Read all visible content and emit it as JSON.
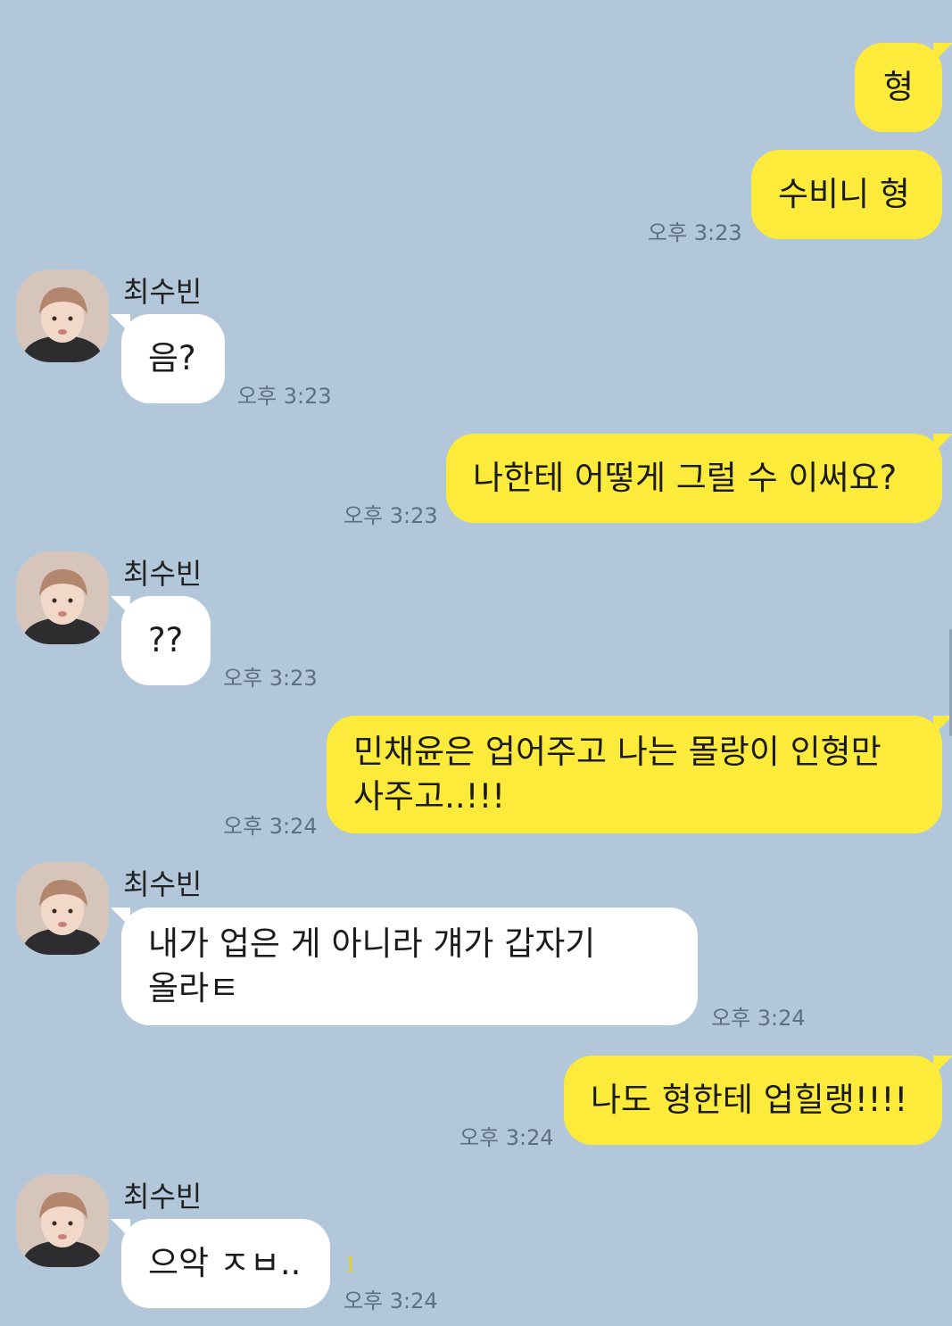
{
  "contact": {
    "name": "최수빈",
    "avatar_icon": "profile-photo"
  },
  "colors": {
    "background": "#b2c7da",
    "outgoing_bubble": "#fdeb3b",
    "incoming_bubble": "#ffffff"
  },
  "messages": [
    {
      "dir": "out",
      "text": "형",
      "time": ""
    },
    {
      "dir": "out",
      "text": "수비니 형",
      "time": "오후 3:23"
    },
    {
      "dir": "in",
      "sender": "최수빈",
      "text": "음?",
      "time": "오후 3:23"
    },
    {
      "dir": "out",
      "text": "나한테 어떻게 그럴 수 이써요?",
      "time": "오후 3:23"
    },
    {
      "dir": "in",
      "sender": "최수빈",
      "text": "??",
      "time": "오후 3:23"
    },
    {
      "dir": "out",
      "text": "민채윤은 업어주고 나는 몰랑이 인형만\n사주고..!!!",
      "time": "오후 3:24"
    },
    {
      "dir": "in",
      "sender": "최수빈",
      "text": "내가 업은 게 아니라 걔가 갑자기\n올라ㅌ",
      "time": "오후 3:24"
    },
    {
      "dir": "out",
      "text": "나도 형한테 업힐랭!!!!",
      "time": "오후 3:24"
    },
    {
      "dir": "in",
      "sender": "최수빈",
      "text": "으악 ㅈㅂ..",
      "time": "오후 3:24",
      "unread": "1"
    }
  ]
}
